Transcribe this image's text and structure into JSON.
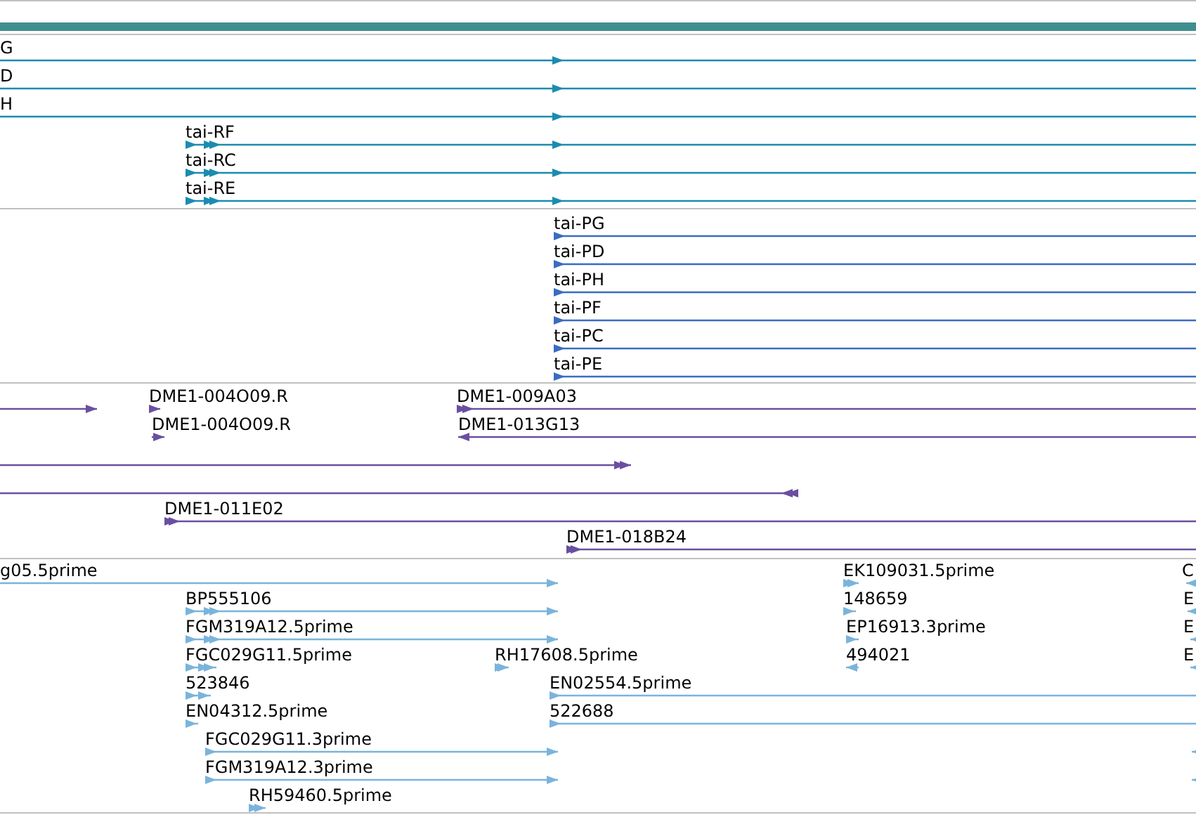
{
  "tracks": [
    {
      "color": "#1a8cb0",
      "features": [
        {
          "label": "G",
          "reverse": false
        },
        {
          "label": "D",
          "reverse": false
        },
        {
          "label": "H",
          "reverse": false
        },
        {
          "label": "tai-RF",
          "reverse": false
        },
        {
          "label": "tai-RC",
          "reverse": false
        },
        {
          "label": "tai-RE",
          "reverse": false
        }
      ]
    },
    {
      "color": "#3a6cc0",
      "features": [
        {
          "label": "tai-PG",
          "reverse": false
        },
        {
          "label": "tai-PD",
          "reverse": false
        },
        {
          "label": "tai-PH",
          "reverse": false
        },
        {
          "label": "tai-PF",
          "reverse": false
        },
        {
          "label": "tai-PC",
          "reverse": false
        },
        {
          "label": "tai-PE",
          "reverse": false
        }
      ]
    },
    {
      "color": "#6a4fa0",
      "features": [
        {
          "reverse": false
        },
        {
          "label": "DME1-004O09.R",
          "reverse": false
        },
        {
          "label": "DME1-009A03",
          "reverse": false
        },
        {
          "label": "DME1-004O09.R",
          "reverse": false
        },
        {
          "label": "DME1-013G13",
          "reverse": true
        },
        {
          "reverse": false
        },
        {
          "reverse": true
        },
        {
          "label": "DME1-011E02",
          "reverse": false
        },
        {
          "label": "DME1-018B24",
          "reverse": false
        }
      ]
    },
    {
      "color": "#7ab4dc",
      "features": [
        {
          "label": "g05.5prime",
          "reverse": false
        },
        {
          "label": "EK109031.5prime",
          "reverse": false
        },
        {
          "label": "C",
          "reverse": true
        },
        {
          "label": "BP555106",
          "reverse": false
        },
        {
          "label": "148659",
          "reverse": false
        },
        {
          "label": "E",
          "reverse": true
        },
        {
          "label": "FGM319A12.5prime",
          "reverse": false
        },
        {
          "label": "EP16913.3prime",
          "reverse": false
        },
        {
          "label": "E",
          "reverse": true
        },
        {
          "label": "FGC029G11.5prime",
          "reverse": false
        },
        {
          "label": "RH17608.5prime",
          "reverse": false
        },
        {
          "label": "494021",
          "reverse": true
        },
        {
          "label": "E",
          "reverse": true
        },
        {
          "label": "523846",
          "reverse": false
        },
        {
          "label": "EN02554.5prime",
          "reverse": false
        },
        {
          "label": "EN04312.5prime",
          "reverse": false
        },
        {
          "label": "522688",
          "reverse": false
        },
        {
          "label": "FGC029G11.3prime",
          "reverse": false
        },
        {
          "reverse": true
        },
        {
          "label": "FGM319A12.3prime",
          "reverse": false
        },
        {
          "reverse": true
        },
        {
          "label": "RH59460.5prime",
          "reverse": false
        }
      ]
    }
  ]
}
